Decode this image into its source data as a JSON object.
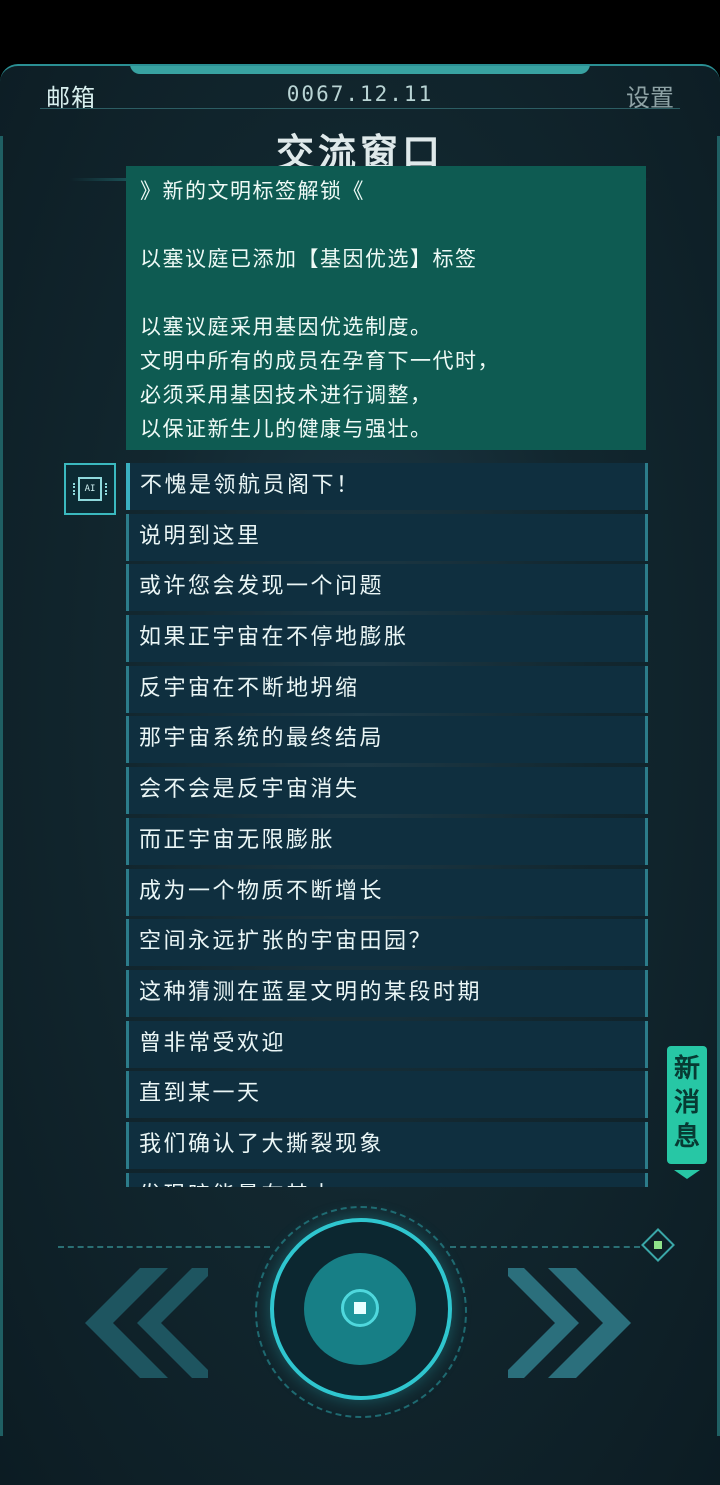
{
  "header": {
    "mail_label": "邮箱",
    "date": "0067.12.11",
    "settings_label": "设置",
    "title": "交流窗口"
  },
  "notice": {
    "heading": "》新的文明标签解锁《",
    "line1": "以塞议庭已添加【基因优选】标签",
    "para1": "以塞议庭采用基因优选制度。",
    "para2": "文明中所有的成员在孕育下一代时，",
    "para3": "必须采用基因技术进行调整，",
    "para4": "以保证新生儿的健康与强壮。"
  },
  "ai_avatar": {
    "label": "AI",
    "icon": "ai-chip-icon"
  },
  "messages": [
    "不愧是领航员阁下！",
    "说明到这里",
    "或许您会发现一个问题",
    "如果正宇宙在不停地膨胀",
    "反宇宙在不断地坍缩",
    "那宇宙系统的最终结局",
    "会不会是反宇宙消失",
    "而正宇宙无限膨胀",
    "成为一个物质不断增长",
    "空间永远扩张的宇宙田园？",
    "这种猜测在蓝星文明的某段时期",
    "曾非常受欢迎",
    "直到某一天",
    "我们确认了大撕裂现象",
    "发现暗能量在其中"
  ],
  "new_message": {
    "label": "新消息"
  },
  "controls": {
    "prev_icon": "double-chevron-left-icon",
    "next_icon": "double-chevron-right-icon",
    "center_icon": "center-record-button-icon"
  },
  "colors": {
    "accent": "#2fc6cf",
    "notice_bg": "#0e5b52",
    "new_message_bg": "#27c7a5",
    "message_bg": "#0f2f3f"
  }
}
